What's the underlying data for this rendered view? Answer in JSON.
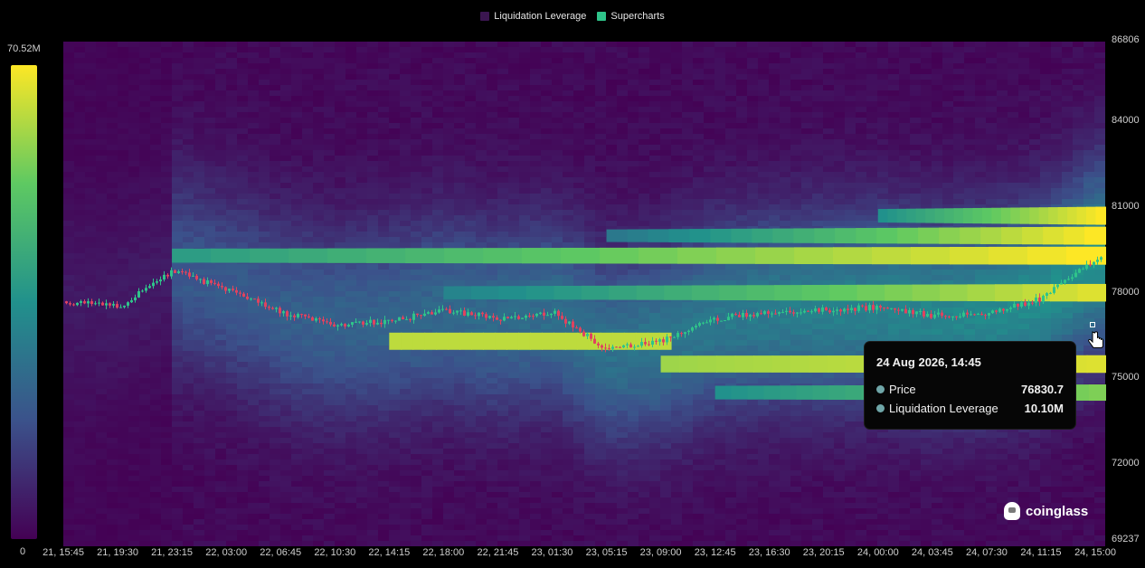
{
  "legend": {
    "items": [
      {
        "label": "Liquidation Leverage",
        "color": "#3b1650"
      },
      {
        "label": "Supercharts",
        "color": "#2fc48a"
      }
    ]
  },
  "colorbar": {
    "max_label": "70.52M",
    "min_label": "0",
    "stops": [
      "#440154",
      "#3b528b",
      "#21918c",
      "#5ec962",
      "#fde725"
    ]
  },
  "chart_data": {
    "type": "heatmap",
    "title": "",
    "xlabel": "",
    "ylabel": "",
    "y_axis": {
      "ticks": [
        "86806",
        "84000",
        "81000",
        "78000",
        "75000",
        "72000",
        "69237"
      ],
      "range": [
        69237,
        86806
      ]
    },
    "x_axis": {
      "ticks": [
        "21, 15:45",
        "21, 19:30",
        "21, 23:15",
        "22, 03:00",
        "22, 06:45",
        "22, 10:30",
        "22, 14:15",
        "22, 18:00",
        "22, 21:45",
        "23, 01:30",
        "23, 05:15",
        "23, 09:00",
        "23, 12:45",
        "23, 16:30",
        "23, 20:15",
        "24, 00:00",
        "24, 03:45",
        "24, 07:30",
        "24, 11:15",
        "24, 15:00"
      ]
    },
    "color_scale": {
      "min": 0,
      "max": 70520000,
      "max_label": "70.52M"
    },
    "liquidation_bands": [
      {
        "price": 79300,
        "from_tick": 2,
        "to_tick": 19,
        "intensity": [
          0.55,
          1.0
        ]
      },
      {
        "price": 78000,
        "from_tick": 7,
        "to_tick": 19,
        "intensity": [
          0.45,
          0.95
        ]
      },
      {
        "price": 80000,
        "from_tick": 10,
        "to_tick": 19,
        "intensity": [
          0.4,
          1.0
        ]
      },
      {
        "price": 80700,
        "from_tick": 15,
        "to_tick": 19,
        "intensity": [
          0.5,
          1.0
        ]
      },
      {
        "price": 76300,
        "from_tick": 6,
        "to_tick": 11,
        "intensity": [
          0.9,
          0.9
        ]
      },
      {
        "price": 75500,
        "from_tick": 11,
        "to_tick": 19,
        "intensity": [
          0.85,
          0.95
        ]
      },
      {
        "price": 74500,
        "from_tick": 12,
        "to_tick": 19,
        "intensity": [
          0.5,
          0.8
        ]
      }
    ],
    "price_series": [
      {
        "x": "21, 15:45",
        "price": 77700
      },
      {
        "x": "21, 19:30",
        "price": 77500
      },
      {
        "x": "21, 23:15",
        "price": 78800
      },
      {
        "x": "22, 03:00",
        "price": 78100
      },
      {
        "x": "22, 06:45",
        "price": 77300
      },
      {
        "x": "22, 10:30",
        "price": 76900
      },
      {
        "x": "22, 14:15",
        "price": 77000
      },
      {
        "x": "22, 18:00",
        "price": 77400
      },
      {
        "x": "22, 21:45",
        "price": 77100
      },
      {
        "x": "23, 01:30",
        "price": 77300
      },
      {
        "x": "23, 05:15",
        "price": 76000
      },
      {
        "x": "23, 09:00",
        "price": 76300
      },
      {
        "x": "23, 12:45",
        "price": 77100
      },
      {
        "x": "23, 16:30",
        "price": 77300
      },
      {
        "x": "23, 20:15",
        "price": 77400
      },
      {
        "x": "24, 00:00",
        "price": 77500
      },
      {
        "x": "24, 03:45",
        "price": 77200
      },
      {
        "x": "24, 07:30",
        "price": 77300
      },
      {
        "x": "24, 11:15",
        "price": 77800
      },
      {
        "x": "24, 15:00",
        "price": 79200
      }
    ]
  },
  "tooltip": {
    "title": "24 Aug 2026, 14:45",
    "rows": [
      {
        "label": "Price",
        "value": "76830.7"
      },
      {
        "label": "Liquidation Leverage",
        "value": "10.10M"
      }
    ]
  },
  "watermark": {
    "text": "coinglass"
  }
}
